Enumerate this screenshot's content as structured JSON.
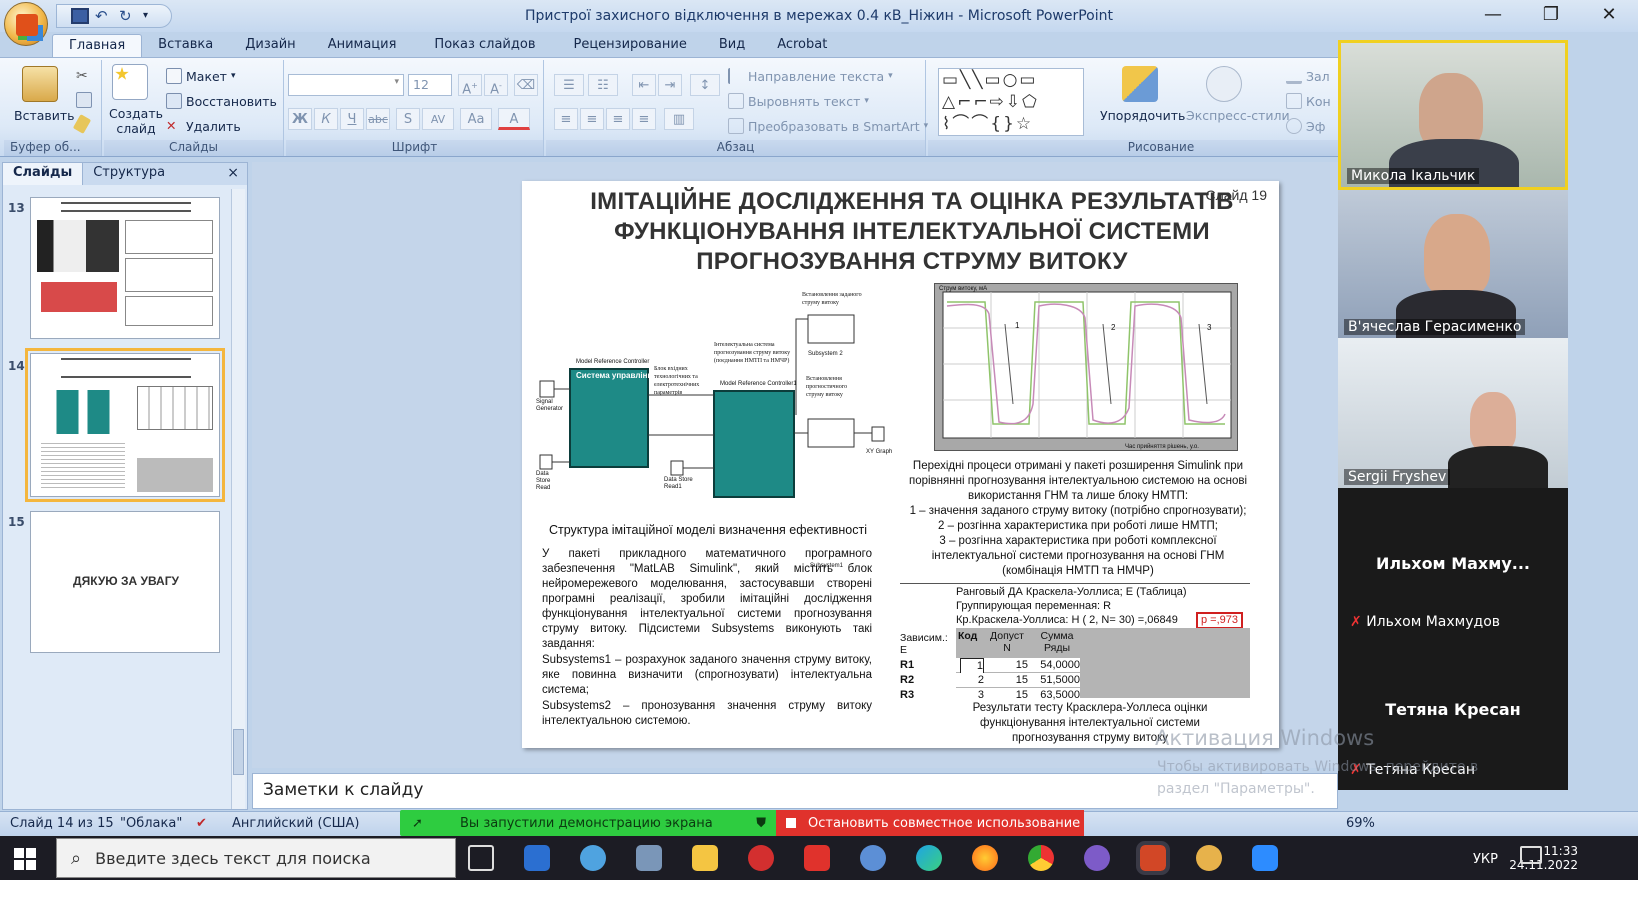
{
  "window": {
    "title": "Пристрої захисного відключення в мережах 0.4 кВ_Ніжин - Microsoft PowerPoint",
    "controls": [
      "—",
      "❐",
      "✕"
    ]
  },
  "ribbon_tabs": [
    "Главная",
    "Вставка",
    "Дизайн",
    "Анимация",
    "Показ слайдов",
    "Рецензирование",
    "Вид",
    "Acrobat"
  ],
  "ribbon": {
    "clipboard": {
      "paste": "Вставить",
      "label": "Буфер об..."
    },
    "slides": {
      "new_slide": "Создать слайд",
      "layout": "Макет",
      "reset": "Восстановить",
      "delete": "Удалить",
      "label": "Слайды"
    },
    "font": {
      "size": "12",
      "label": "Шрифт",
      "bold": "Ж",
      "italic": "К",
      "underline": "Ч",
      "strike": "abc",
      "shadow": "S",
      "spacing": "AV",
      "case": "Aa",
      "color": "A"
    },
    "paragraph": {
      "text_direction": "Направление текста",
      "align_text": "Выровнять текст",
      "smartart": "Преобразовать в SmartArt",
      "label": "Абзац"
    },
    "drawing": {
      "arrange": "Упорядочить",
      "quick_styles": "Экспресс-стили",
      "fill": "Зал",
      "outline": "Кон",
      "effects": "Эф",
      "label": "Рисование"
    }
  },
  "panel": {
    "tabs": [
      "Слайды",
      "Структура"
    ],
    "close": "×",
    "slide_numbers": [
      "13",
      "14",
      "15"
    ],
    "thumb15_text": "ДЯКУЮ ЗА УВАГУ"
  },
  "slide": {
    "number_label": "Слайд 19",
    "title": "ІМІТАЦІЙНЕ ДОСЛІДЖЕННЯ ТА ОЦІНКА РЕЗУЛЬТАТІВ ФУНКЦІОНУВАННЯ ІНТЕЛЕКТУАЛЬНОЇ СИСТЕМИ ПРОГНОЗУВАННЯ СТРУМУ ВИТОКУ",
    "model_caption": "Структура імітаційної моделі визначення ефективності",
    "body_paragraph": "У пакеті прикладного математичного програмного забезпечення \"MatLAB Simulink\", який містить блок нейромережевого моделювання, застосувавши створені програмні реалізації, зробили імітаційні дослідження функціонування інтелектуальної системи прогнозування струму витоку. Підсистеми Subsystems виконують такі завдання:",
    "body_item1": "Subsystems1 – розрахунок заданого значення струму витоку, яке повинна визначити (спрогнозувати) інтелектуальна система;",
    "body_item2": "Subsystems2 – пронозування значення струму витоку інтелектуальною системою.",
    "chart_caption": "Перехідні процеси отримані у пакеті розширення Simulink при порівнянні прогнозування інтелектуальною системою на основі використання ГНМ та лише блоку НМТП:",
    "chart_item1": "1 – значення заданого струму витоку (потрібно спрогнозувати);",
    "chart_item2": "2 – розгінна характеристика при роботі лише НМТП;",
    "chart_item3": "3 – розгінна характеристика при роботі комплексної інтелектуальної системи прогнозування на основі ГНМ (комбінація НМТП та НМЧР)",
    "table_head1": "Ранговый ДА Краскела-Уоллиса; Е (Таблица)",
    "table_head2": "Группирующая переменная: R",
    "table_head3": "Кр.Краскела-Уоллиса: H ( 2, N= 30) =,06849",
    "table_p": "p =,973",
    "table_cols": [
      "Зависим.: E",
      "Код",
      "Допуст N",
      "Сумма Ряды"
    ],
    "table_rows": [
      [
        "R1",
        "1",
        "15",
        "54,0000"
      ],
      [
        "R2",
        "2",
        "15",
        "51,5000"
      ],
      [
        "R3",
        "3",
        "15",
        "63,5000"
      ]
    ],
    "table_caption": "Результати тесту Красклера-Уоллеса оцінки функціонування інтелектуальної системи прогнозування струму витоку",
    "diagram_labels": {
      "mrc1": "Model Reference Controller",
      "ctrl": "Система управління",
      "block_in": "Блок вхідних технологічних та електротехнічних параметрів",
      "intel": "Інтелектуальна система прогнозування струму витоку (поєднання НМТП та НМЧР)",
      "mrc2": "Model Reference Controller1",
      "set_current": "Встановлення заданого струму витоку",
      "forecast": "Встановлення прогностичного струму витоку",
      "sub1": "Subsystem1",
      "sub2": "Subsystem 2",
      "signal": "Signal Generator",
      "ds_read": "Data Store Read",
      "ds_read1": "Data Store Read1",
      "xy": "XY Graph",
      "y_label": "Струм витоку, мА",
      "x_label": "Час прийняття рішень, у.о.",
      "curve_labels": [
        "1",
        "2",
        "3"
      ]
    }
  },
  "notes": "Заметки к слайду",
  "status": {
    "slide": "Слайд 14 из 15",
    "theme": "\"Облака\"",
    "language": "Английский (США)",
    "zoom": "69%"
  },
  "screen_share": {
    "notice": "Вы запустили демонстрацию экрана",
    "stop": "Остановить совместное использование"
  },
  "participants": [
    {
      "name": "Микола Ікальчик"
    },
    {
      "name": "В'ячеслав Герасименко"
    },
    {
      "name": "Sergii Fryshev"
    },
    {
      "name": "Ильхом  Махму...",
      "sub": "Ильхом Махмудов"
    },
    {
      "name": "Тетяна Кресан",
      "sub": "Тетяна Кресан"
    }
  ],
  "watermark": {
    "line1": "Активация Windows",
    "line2": "Чтобы активировать Windows, перейдите в раздел \"Параметры\"."
  },
  "taskbar": {
    "search_placeholder": "Введите здесь текст для поиска",
    "lang": "УКР",
    "time": "11:33",
    "date": "24.11.2022"
  },
  "colors": {
    "simulink_block": "#1e8a86",
    "share_green": "#2ecc40",
    "share_red": "#e0322c",
    "selected_thumb": "#f4b63e"
  }
}
